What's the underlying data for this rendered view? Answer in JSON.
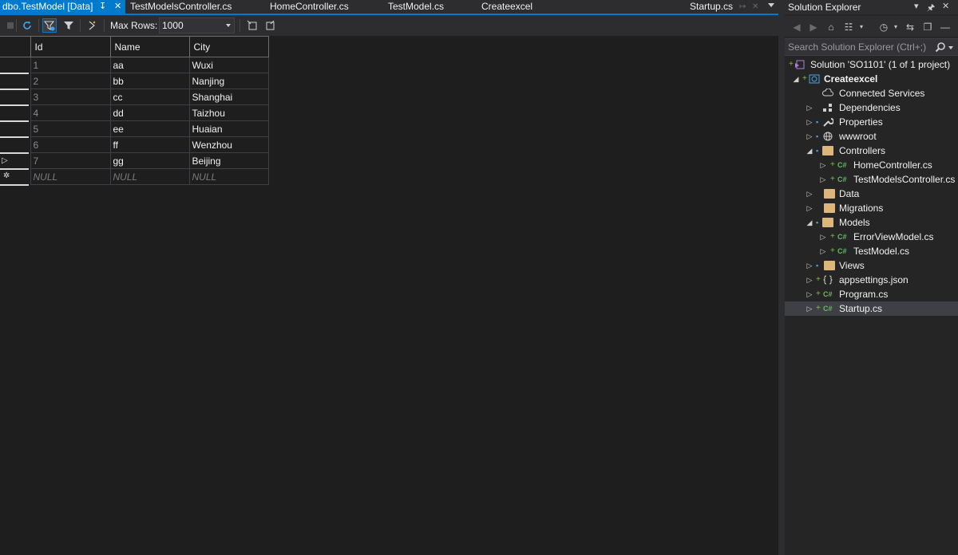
{
  "tabs": {
    "active_label": "dbo.TestModel [Data]",
    "items": [
      {
        "label": "TestModelsController.cs"
      },
      {
        "label": "HomeController.cs"
      },
      {
        "label": "TestModel.cs"
      },
      {
        "label": "Createexcel"
      },
      {
        "label": "Startup.cs"
      }
    ]
  },
  "toolbar": {
    "max_rows_label": "Max Rows:",
    "max_rows_value": "1000"
  },
  "grid": {
    "columns": [
      "Id",
      "Name",
      "City"
    ],
    "rows": [
      {
        "id": "1",
        "name": "aa",
        "city": "Wuxi"
      },
      {
        "id": "2",
        "name": "bb",
        "city": "Nanjing"
      },
      {
        "id": "3",
        "name": "cc",
        "city": "Shanghai"
      },
      {
        "id": "4",
        "name": "dd",
        "city": "Taizhou"
      },
      {
        "id": "5",
        "name": "ee",
        "city": "Huaian"
      },
      {
        "id": "6",
        "name": "ff",
        "city": "Wenzhou"
      },
      {
        "id": "7",
        "name": "gg",
        "city": "Beijing"
      }
    ],
    "new_row": {
      "id": "NULL",
      "name": "NULL",
      "city": "NULL"
    },
    "current_row_marker_icon": "triangle-right-icon",
    "new_row_marker_icon": "asterisk-icon"
  },
  "solution_explorer": {
    "title": "Solution Explorer",
    "search_placeholder": "Search Solution Explorer (Ctrl+;)",
    "tree": [
      {
        "label": "Solution 'SO1101' (1 of 1 project)",
        "icon": "solution-icon"
      },
      {
        "label": "Createexcel",
        "icon": "web-project-icon"
      },
      {
        "label": "Connected Services",
        "icon": "cloud-icon"
      },
      {
        "label": "Dependencies",
        "icon": "dependencies-icon"
      },
      {
        "label": "Properties",
        "icon": "wrench-icon"
      },
      {
        "label": "wwwroot",
        "icon": "globe-icon"
      },
      {
        "label": "Controllers",
        "icon": "folder-open-icon"
      },
      {
        "label": "HomeController.cs",
        "icon": "csharp-file-icon"
      },
      {
        "label": "TestModelsController.cs",
        "icon": "csharp-file-icon"
      },
      {
        "label": "Data",
        "icon": "folder-icon"
      },
      {
        "label": "Migrations",
        "icon": "folder-icon"
      },
      {
        "label": "Models",
        "icon": "folder-open-icon"
      },
      {
        "label": "ErrorViewModel.cs",
        "icon": "csharp-file-icon"
      },
      {
        "label": "TestModel.cs",
        "icon": "csharp-file-icon"
      },
      {
        "label": "Views",
        "icon": "folder-icon"
      },
      {
        "label": "appsettings.json",
        "icon": "json-file-icon"
      },
      {
        "label": "Program.cs",
        "icon": "csharp-file-icon"
      },
      {
        "label": "Startup.cs",
        "icon": "csharp-file-icon"
      }
    ],
    "selected_item": "Startup.cs"
  },
  "colors": {
    "accent": "#007acc",
    "background": "#1e1e1e",
    "panel": "#252526",
    "chrome": "#2d2d30",
    "selected_row": "#3f3f46",
    "csharp_icon": "#67b864",
    "folder_icon": "#dcb67a"
  }
}
